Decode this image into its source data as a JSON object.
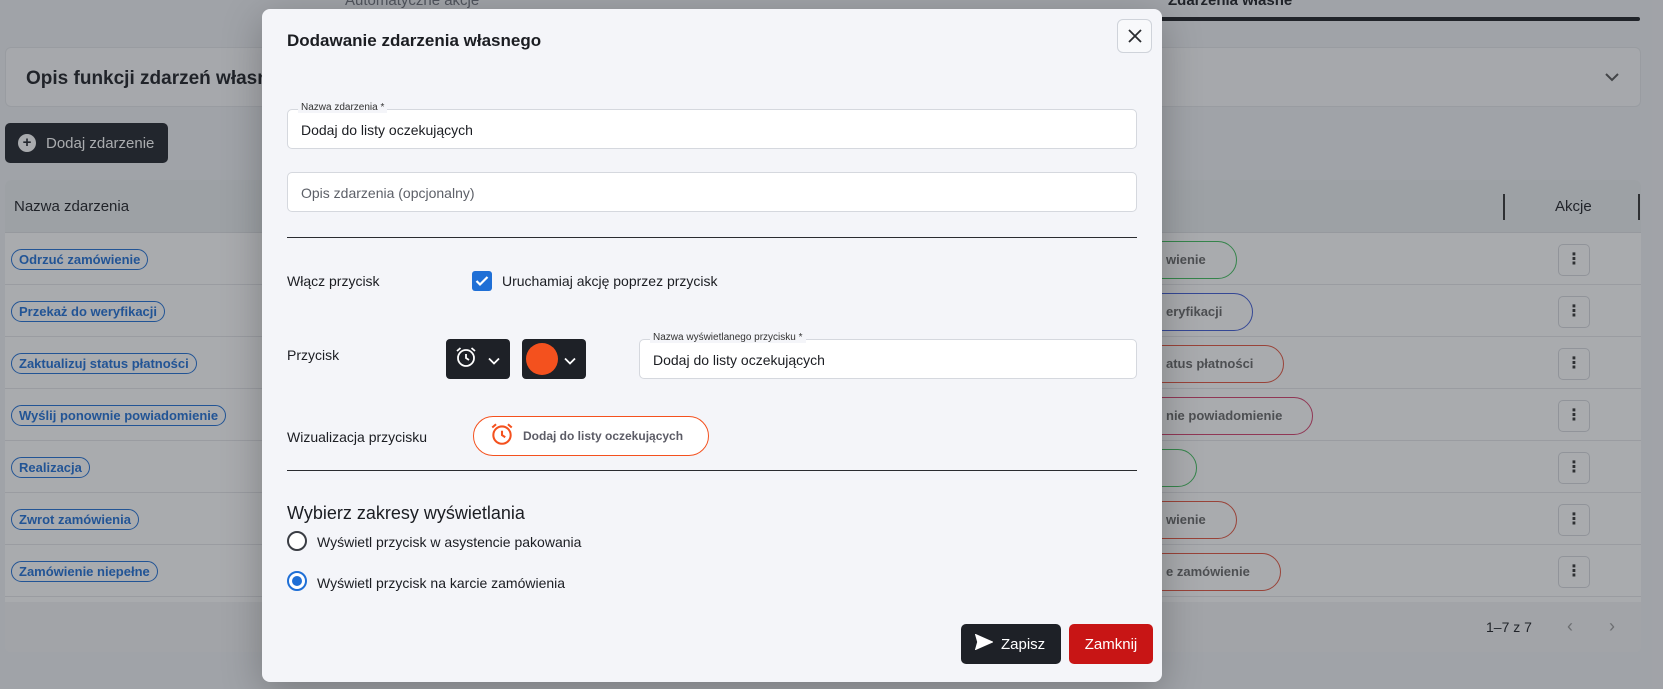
{
  "background": {
    "tabs": {
      "left": "Automatyczne akcje",
      "right": "Zdarzenia własne"
    },
    "panel_title": "Opis funkcji zdarzeń własnych",
    "add_button": "Dodaj zdarzenie",
    "table": {
      "col_name": "Nazwa zdarzenia",
      "col_actions": "Akcje",
      "rows": [
        {
          "name": "Odrzuć zamówienie",
          "pill": "wienie",
          "pill_color": "#3fbf5a"
        },
        {
          "name": "Przekaż do weryfikacji",
          "pill": "eryfikacji",
          "pill_color": "#3f5ad6"
        },
        {
          "name": "Zaktualizuj status płatności",
          "pill": "atus płatności",
          "pill_color": "#e5533d"
        },
        {
          "name": "Wyślij ponownie powiadomienie",
          "pill": "nie powiadomienie",
          "pill_color": "#d63f6b"
        },
        {
          "name": "Realizacja",
          "pill": "",
          "pill_color": "#3fbf5a"
        },
        {
          "name": "Zwrot zamówienia",
          "pill": "wienie",
          "pill_color": "#e5533d"
        },
        {
          "name": "Zamówienie niepełne",
          "pill": "e zamówienie",
          "pill_color": "#e5533d"
        }
      ],
      "pagination": "1–7 z 7"
    }
  },
  "modal": {
    "title": "Dodawanie zdarzenia własnego",
    "event_name": {
      "label": "Nazwa zdarzenia *",
      "value": "Dodaj do listy oczekujących"
    },
    "event_description": {
      "placeholder": "Opis zdarzenia (opcjonalny)"
    },
    "enable_button": {
      "label": "Włącz przycisk",
      "checkbox_label": "Uruchamiaj akcję poprzez przycisk",
      "checked": true
    },
    "button_row": {
      "label": "Przycisk",
      "icon": "alarm-clock-icon",
      "color": "#f4511e",
      "display_name": {
        "label": "Nazwa wyświetlanego przycisku *",
        "value": "Dodaj do listy oczekujących"
      }
    },
    "visualization": {
      "label": "Wizualizacja przycisku",
      "text": "Dodaj do listy oczekujących"
    },
    "scopes": {
      "title": "Wybierz zakresy wyświetlania",
      "options": [
        {
          "label": "Wyświetl przycisk w asystencie pakowania",
          "selected": false
        },
        {
          "label": "Wyświetl przycisk na karcie zamówienia",
          "selected": true
        }
      ]
    },
    "save": "Zapisz",
    "close": "Zamknij"
  }
}
